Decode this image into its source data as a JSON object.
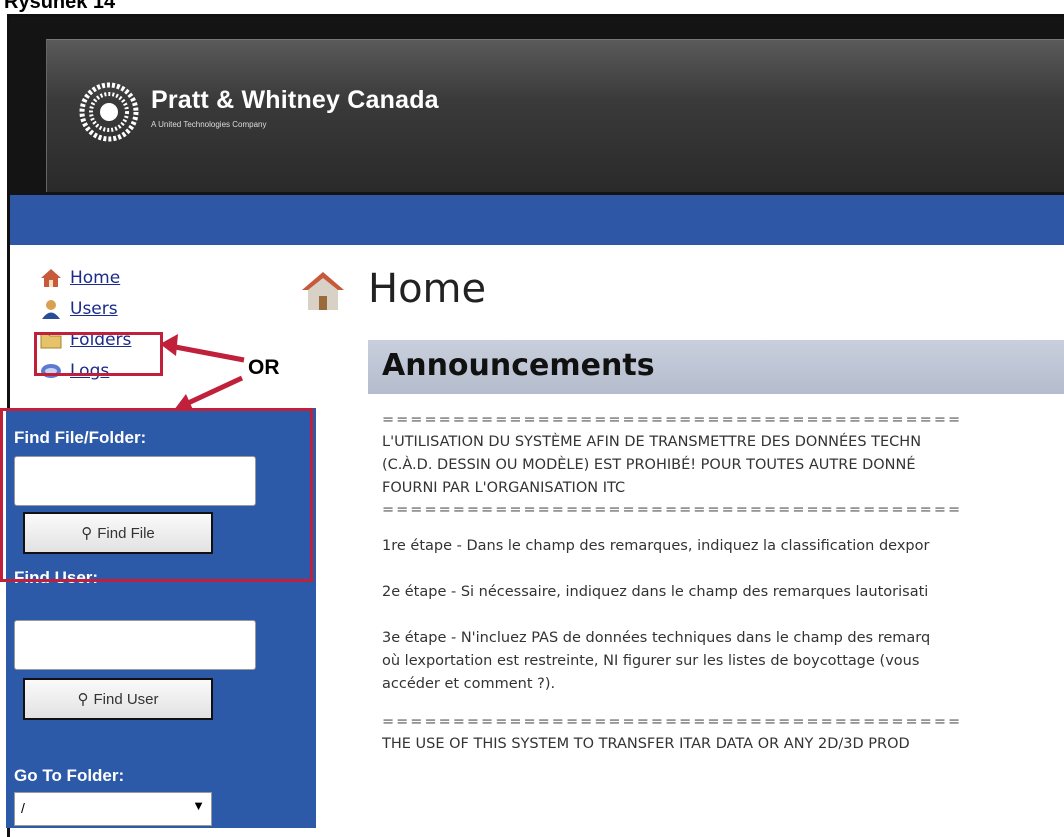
{
  "figure_title": "Rysunek 14",
  "brand": {
    "name": "Pratt & Whitney Canada",
    "tagline": "A United Technologies Company"
  },
  "nav": {
    "items": [
      {
        "label": "Home",
        "icon": "house-icon"
      },
      {
        "label": "Users",
        "icon": "user-icon"
      },
      {
        "label": "Folders",
        "icon": "folder-icon"
      },
      {
        "label": "Logs",
        "icon": "logs-icon"
      }
    ]
  },
  "annotation": {
    "or_label": "OR",
    "color": "#c0203a"
  },
  "sidebar": {
    "find_file_label": "Find File/Folder:",
    "find_file_value": "",
    "find_file_button": "Find File",
    "find_user_label": "Find User:",
    "find_user_value": "",
    "find_user_button": "Find User",
    "go_to_folder_label": "Go To Folder:",
    "go_to_folder_value": "/"
  },
  "page": {
    "title": "Home",
    "announcements_title": "Announcements"
  },
  "announcements": {
    "separator": "=========================================",
    "lines_fr": [
      "L'UTILISATION DU SYSTÈME AFIN DE TRANSMETTRE DES DONNÉES TECHN",
      "(C.À.D. DESSIN OU MODÈLE) EST PROHIBÉ! POUR TOUTES AUTRE DONNÉ",
      "FOURNI PAR L'ORGANISATION ITC"
    ],
    "step1": "1re étape - Dans le champ des remarques, indiquez la classification dexpor",
    "step2": "2e étape - Si nécessaire, indiquez dans le champ des remarques lautorisati",
    "step3_line1": "3e étape - N'incluez PAS de données techniques dans le champ des remarq",
    "step3_line2": "où lexportation est restreinte, NI figurer sur les listes de boycottage (vous",
    "step3_line3": "accéder et comment ?).",
    "line_en": "THE USE OF THIS SYSTEM TO TRANSFER ITAR DATA OR ANY 2D/3D PROD"
  },
  "colors": {
    "sidebar_blue": "#2d5aa8",
    "highlight_red": "#c0203a",
    "banner_dark": "#141414"
  }
}
